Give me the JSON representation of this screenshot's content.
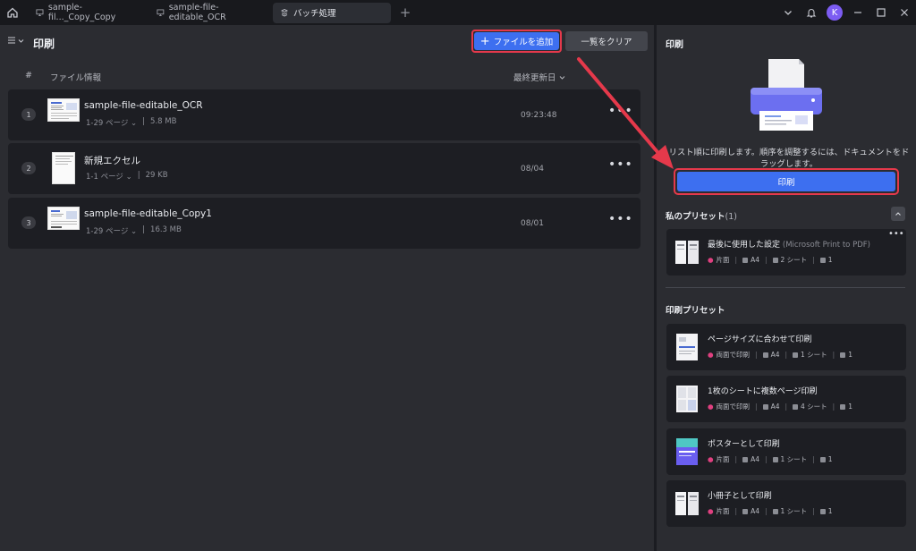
{
  "titlebar": {
    "tabs": [
      {
        "label": "sample-fil..._Copy_Copy"
      },
      {
        "label": "sample-file-editable_OCR"
      },
      {
        "label": "バッチ処理"
      }
    ],
    "avatar_initial": "K"
  },
  "left": {
    "title": "印刷",
    "add_file_label": "ファイルを追加",
    "clear_list_label": "一覧をクリア",
    "columns": {
      "num": "#",
      "info": "ファイル情報",
      "date": "最終更新日"
    },
    "files": [
      {
        "num": "1",
        "name": "sample-file-editable_OCR",
        "pages": "1-29 ページ",
        "size": "5.8 MB",
        "date": "09:23:48"
      },
      {
        "num": "2",
        "name": "新規エクセル",
        "pages": "1-1 ページ",
        "size": "29 KB",
        "date": "08/04"
      },
      {
        "num": "3",
        "name": "sample-file-editable_Copy1",
        "pages": "1-29 ページ",
        "size": "16.3 MB",
        "date": "08/01"
      }
    ]
  },
  "right": {
    "title": "印刷",
    "description": "リスト順に印刷します。順序を調整するには、ドキュメントをドラッグします。",
    "print_label": "印刷",
    "my_presets": {
      "title": "私のプリセット",
      "count": "(1)"
    },
    "my_preset_items": [
      {
        "name": "最後に使用した設定",
        "printer": "(Microsoft Print to PDF)",
        "sides": "片面",
        "paper": "A4",
        "sheets": "2 シート",
        "copies": "1"
      }
    ],
    "print_presets": {
      "title": "印刷プリセット"
    },
    "preset_items": [
      {
        "name": "ページサイズに合わせて印刷",
        "sides": "両面で印刷",
        "paper": "A4",
        "sheets": "1 シート",
        "copies": "1"
      },
      {
        "name": "1枚のシートに複数ページ印刷",
        "sides": "両面で印刷",
        "paper": "A4",
        "sheets": "4 シート",
        "copies": "1"
      },
      {
        "name": "ポスターとして印刷",
        "sides": "片面",
        "paper": "A4",
        "sheets": "1 シート",
        "copies": "1"
      },
      {
        "name": "小冊子として印刷",
        "sides": "片面",
        "paper": "A4",
        "sheets": "1 シート",
        "copies": "1"
      }
    ]
  },
  "colors": {
    "accent": "#3d6ff0",
    "highlight": "#e5394b",
    "avatar": "#7c5cf2"
  }
}
